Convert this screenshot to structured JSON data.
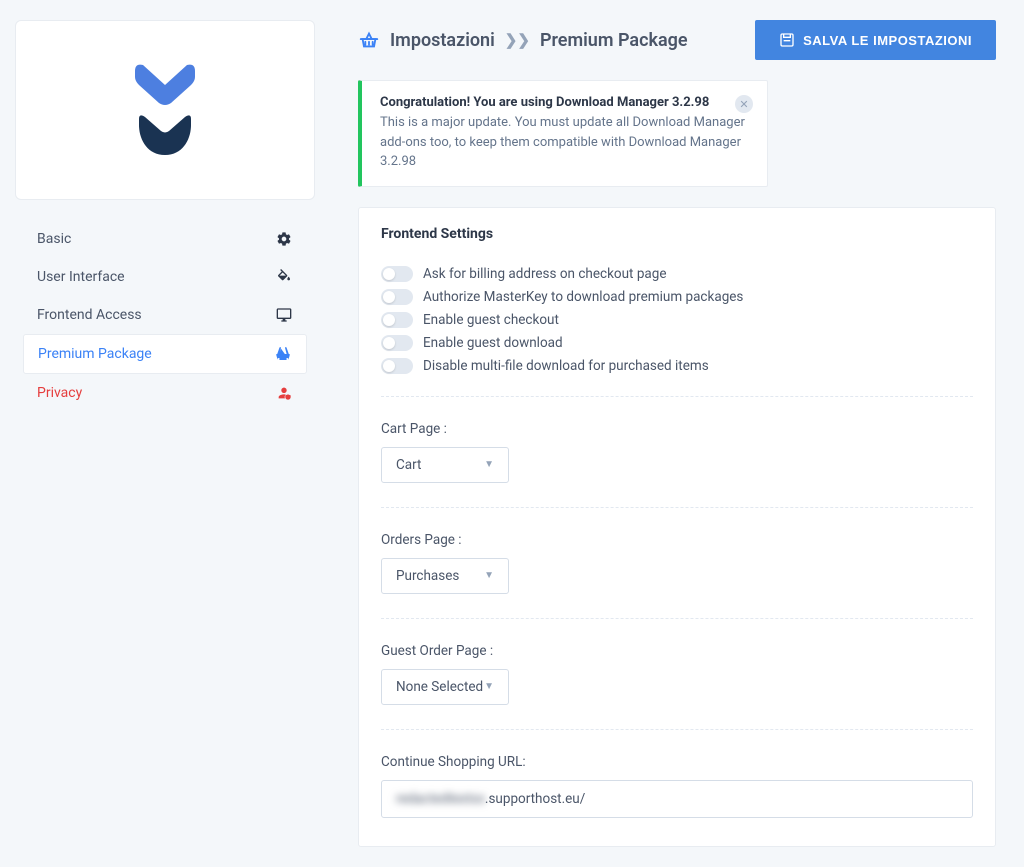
{
  "header": {
    "title_part1": "Impostazioni",
    "title_part2": "Premium Package",
    "save_button": "SALVA LE IMPOSTAZIONI"
  },
  "alert": {
    "title": "Congratulation! You are using Download Manager 3.2.98",
    "body": "This is a major update. You must update all Download Manager add-ons too, to keep them compatible with Download Manager 3.2.98"
  },
  "sidebar": {
    "items": [
      {
        "label": "Basic",
        "icon": "gear"
      },
      {
        "label": "User Interface",
        "icon": "paint"
      },
      {
        "label": "Frontend Access",
        "icon": "monitor"
      },
      {
        "label": "Premium Package",
        "icon": "basket"
      },
      {
        "label": "Privacy",
        "icon": "user-shield"
      }
    ]
  },
  "panel": {
    "title": "Frontend Settings",
    "toggles": [
      {
        "label": "Ask for billing address on checkout page",
        "on": false
      },
      {
        "label": "Authorize MasterKey to download premium packages",
        "on": false
      },
      {
        "label": "Enable guest checkout",
        "on": false
      },
      {
        "label": "Enable guest download",
        "on": false
      },
      {
        "label": "Disable multi-file download for purchased items",
        "on": false
      }
    ],
    "cart_page_label": "Cart Page :",
    "cart_page_value": "Cart",
    "orders_page_label": "Orders Page :",
    "orders_page_value": "Purchases",
    "guest_order_page_label": "Guest Order Page :",
    "guest_order_page_value": "None Selected",
    "continue_shopping_label": "Continue Shopping URL:",
    "continue_shopping_prefix": "redactedtextxx",
    "continue_shopping_suffix": ".supporthost.eu/"
  }
}
